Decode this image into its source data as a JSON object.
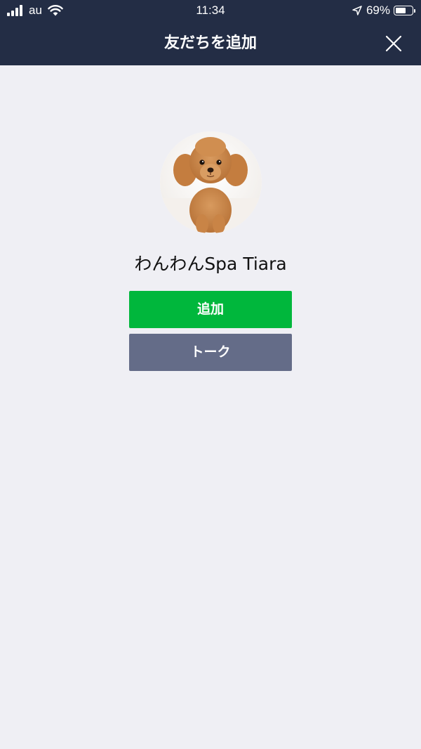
{
  "status_bar": {
    "carrier": "au",
    "time": "11:34",
    "battery_percent": "69%",
    "battery_level": 0.69
  },
  "nav": {
    "title": "友だちを追加",
    "close_icon": "close-icon"
  },
  "profile": {
    "avatar": "poodle-avatar",
    "name": "わんわんSpa Tiara"
  },
  "buttons": {
    "add_label": "追加",
    "talk_label": "トーク"
  },
  "colors": {
    "header_bg": "#232d45",
    "body_bg": "#efeff4",
    "add_button": "#00b73c",
    "talk_button": "#646c88"
  }
}
